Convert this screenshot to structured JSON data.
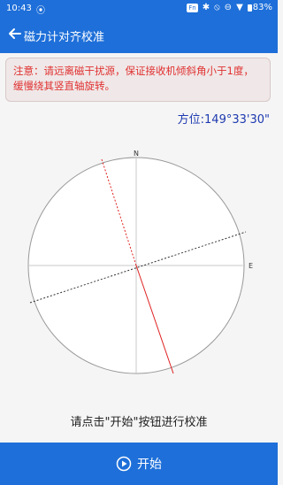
{
  "status_bar": {
    "time": "10:43",
    "sync_icon": "sync-icon",
    "nfc": "Fn",
    "battery": "83%"
  },
  "app_bar": {
    "title": "磁力计对齐校准"
  },
  "notice": {
    "text": "注意：请远离磁干扰源，保证接收机倾斜角小于1度，缓慢绕其竖直轴旋转。"
  },
  "azimuth": "方位:149°33'30\"",
  "compass": {
    "north_label": "N",
    "east_label": "E",
    "red_line_color": "#e02020",
    "dark_line_color": "#333333"
  },
  "hint": "请点击\"开始\"按钮进行校准",
  "start_button": {
    "label": "开始"
  }
}
